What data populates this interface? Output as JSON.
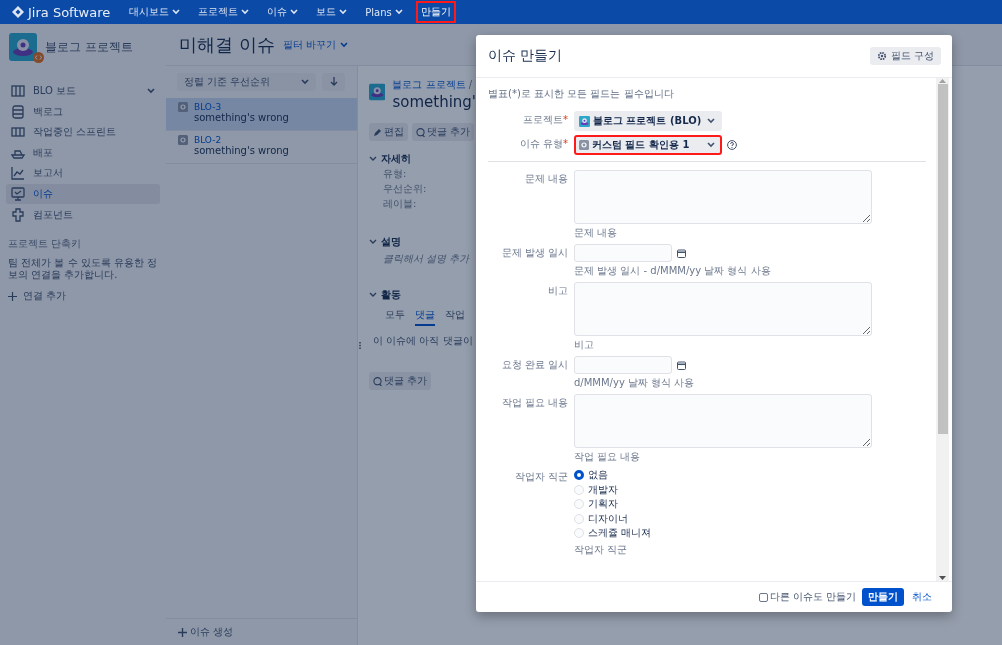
{
  "nav": {
    "product": "Jira Software",
    "items": [
      {
        "label": "대시보드",
        "dropdown": true,
        "highlighted": false
      },
      {
        "label": "프로젝트",
        "dropdown": true,
        "highlighted": false
      },
      {
        "label": "이슈",
        "dropdown": true,
        "highlighted": false
      },
      {
        "label": "보드",
        "dropdown": true,
        "highlighted": false
      },
      {
        "label": "Plans",
        "dropdown": true,
        "highlighted": false
      },
      {
        "label": "만들기",
        "dropdown": false,
        "highlighted": true
      }
    ]
  },
  "sidebar": {
    "project": "블로그 프로젝트",
    "items": [
      {
        "label": "BLO 보드",
        "kind": "board",
        "expandable": true,
        "selected": false
      },
      {
        "label": "백로그",
        "kind": "backlog",
        "expandable": false,
        "selected": false
      },
      {
        "label": "작업중인 스프린트",
        "kind": "sprint",
        "expandable": false,
        "selected": false
      },
      {
        "label": "배포",
        "kind": "release",
        "expandable": false,
        "selected": false
      },
      {
        "label": "보고서",
        "kind": "reports",
        "expandable": false,
        "selected": false
      },
      {
        "label": "이슈",
        "kind": "issues",
        "expandable": false,
        "selected": true
      },
      {
        "label": "컴포넌트",
        "kind": "components",
        "expandable": false,
        "selected": false
      }
    ],
    "shortcuts": {
      "title": "프로젝트 단축키",
      "text": "팀 전체가 볼 수 있도록 유용한 정보의 연결을 추가합니다.",
      "add_link": "연결 추가"
    }
  },
  "page": {
    "title": "미해결 이슈",
    "filter": "필터 바꾸기"
  },
  "issue_list": {
    "sort": "정렬 기준 우선순위",
    "items": [
      {
        "key": "BLO-3",
        "summary": "something's wrong",
        "selected": true
      },
      {
        "key": "BLO-2",
        "summary": "something's wrong",
        "selected": false
      }
    ],
    "create": "이슈 생성"
  },
  "detail": {
    "breadcrumb": "블로그 프로젝트",
    "separator": "/",
    "title": "something'",
    "buttons": [
      "편집",
      "댓글 추가"
    ],
    "details": {
      "title": "자세히",
      "labels": [
        "유형:",
        "우선순위:",
        "레이블:"
      ]
    },
    "description": {
      "title": "설명",
      "prompt": "클릭해서 설명 추가"
    },
    "activity": {
      "title": "활동",
      "tabs": [
        {
          "label": "모두",
          "selected": false
        },
        {
          "label": "댓글",
          "selected": true
        },
        {
          "label": "작업",
          "selected": false
        }
      ],
      "empty": "이 이슈에 아직 댓글이",
      "add_comment": "댓글 추가"
    }
  },
  "dialog": {
    "title": "이슈 만들기",
    "configure": "필드 구성",
    "required_note": "별표(*)로 표시한 모든 필드는 필수입니다",
    "fields": [
      {
        "kind": "project-select",
        "label": "프로젝트",
        "required_mark": "*",
        "value": "블로그 프로젝트 (BLO)",
        "highlighted": false
      },
      {
        "kind": "type-select",
        "label": "이슈 유형",
        "required_mark": "*",
        "value": "커스텀 필드 확인용 1",
        "highlighted": true,
        "help": true
      },
      {
        "kind": "textarea",
        "label": "문제 내용",
        "description": "문제 내용"
      },
      {
        "kind": "date",
        "label": "문제 발생 일시",
        "description": "문제 발생 일시 - d/MMM/yy 날짜 형식 사용"
      },
      {
        "kind": "textarea",
        "label": "비고",
        "description": "비고"
      },
      {
        "kind": "date",
        "label": "요청 완료 일시",
        "description": "d/MMM/yy 날짜 형식 사용"
      },
      {
        "kind": "textarea",
        "label": "작업 필요 내용",
        "description": "작업 필요 내용"
      },
      {
        "kind": "radio",
        "label": "작업자 직군",
        "options": [
          {
            "label": "없음",
            "selected": true
          },
          {
            "label": "개발자",
            "selected": false
          },
          {
            "label": "기획자",
            "selected": false
          },
          {
            "label": "디자이너",
            "selected": false
          },
          {
            "label": "스케쥴 매니져",
            "selected": false
          }
        ],
        "description": "작업자 직군"
      }
    ],
    "create_another": {
      "label": "다른 이슈도 만들기",
      "checked": false
    },
    "submit": "만들기",
    "cancel": "취소"
  }
}
